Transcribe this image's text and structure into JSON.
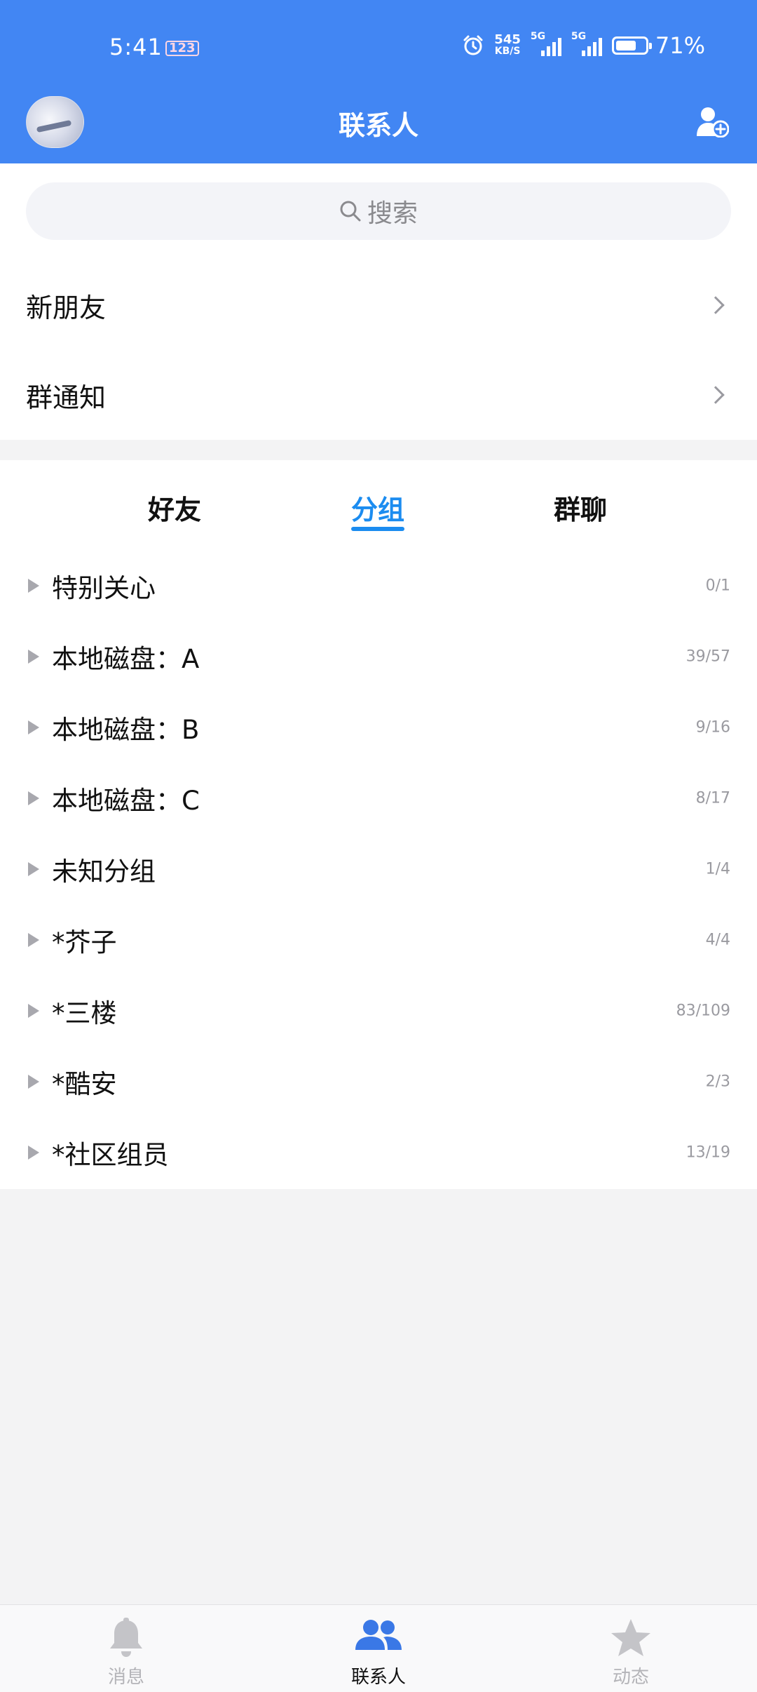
{
  "status_bar": {
    "time": "5:41",
    "badge": "123",
    "net_speed": "545",
    "net_unit": "KB/S",
    "sig1_label": "5G",
    "sig2_label": "5G",
    "battery": "71%",
    "battery_level": 0.71
  },
  "header": {
    "title": "联系人",
    "avatar_icon": "avatar",
    "add_icon": "add-contact-icon"
  },
  "search": {
    "placeholder": "搜索"
  },
  "entries": [
    {
      "label": "新朋友"
    },
    {
      "label": "群通知"
    }
  ],
  "tabs": [
    {
      "label": "好友",
      "active": false
    },
    {
      "label": "分组",
      "active": true
    },
    {
      "label": "群聊",
      "active": false
    }
  ],
  "groups": [
    {
      "name": "特别关心",
      "count": "0/1"
    },
    {
      "name": "本地磁盘：A",
      "count": "39/57"
    },
    {
      "name": "本地磁盘：B",
      "count": "9/16"
    },
    {
      "name": "本地磁盘：C",
      "count": "8/17"
    },
    {
      "name": "未知分组",
      "count": "1/4"
    },
    {
      "name": "*芥子",
      "count": "4/4"
    },
    {
      "name": "*三楼",
      "count": "83/109"
    },
    {
      "name": "*酷安",
      "count": "2/3"
    },
    {
      "name": "*社区组员",
      "count": "13/19"
    }
  ],
  "bottom_nav": [
    {
      "label": "消息",
      "icon": "bell-icon",
      "active": false
    },
    {
      "label": "联系人",
      "icon": "contacts-icon",
      "active": true
    },
    {
      "label": "动态",
      "icon": "star-icon",
      "active": false
    }
  ],
  "colors": {
    "header_blue": "#4286f3",
    "tab_active": "#1b8cf0"
  }
}
